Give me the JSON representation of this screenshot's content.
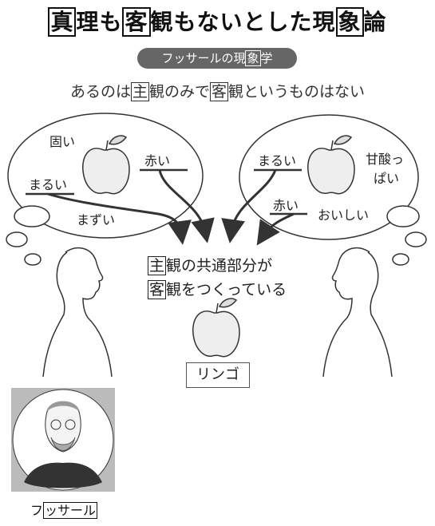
{
  "title": {
    "c1": "真",
    "t1": "理も",
    "c2": "客",
    "t2": "観もないとした現",
    "c3": "象",
    "t3": "論"
  },
  "pill": {
    "t1": "フッサールの現",
    "c1": "象",
    "t2": "学"
  },
  "subtitle": {
    "t1": "あるのは",
    "c1": "主",
    "t2": "観のみで",
    "c2": "客",
    "t3": "観というものはない"
  },
  "left_bubble": {
    "hard": "固い",
    "red": "赤い",
    "round": "まるい",
    "bad": "まずい"
  },
  "right_bubble": {
    "round": "まるい",
    "sour1": "甘酸っ",
    "sour2": "ぱい",
    "red": "赤い",
    "tasty": "おいしい"
  },
  "center": {
    "line1_c": "主",
    "line1_t": "観の共通部分が",
    "line2_c": "客",
    "line2_t": "観をつくっている"
  },
  "apple_label": "リンゴ",
  "caption": {
    "t1": "フ",
    "c1": "ッサール"
  },
  "colors": {
    "ink": "#222222",
    "pill_bg": "#666666",
    "apple_fill": "#eeeeee"
  }
}
